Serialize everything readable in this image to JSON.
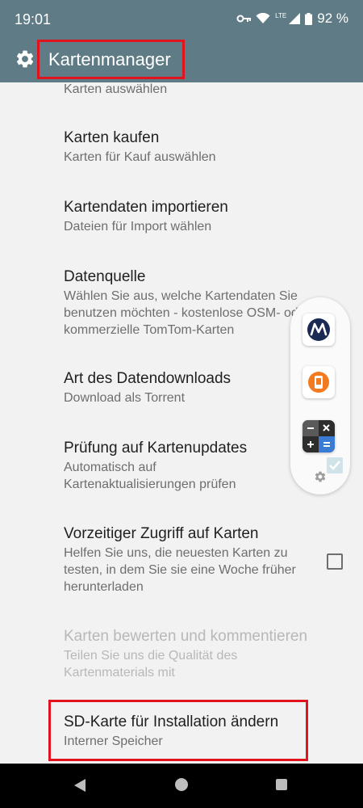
{
  "status": {
    "time": "19:01",
    "network": "LTE",
    "battery": "92 %"
  },
  "app_bar": {
    "title": "Kartenmanager"
  },
  "list": {
    "items": [
      {
        "title": "",
        "subtitle": "Karten auswählen"
      },
      {
        "title": "Karten kaufen",
        "subtitle": "Karten für Kauf auswählen"
      },
      {
        "title": "Kartendaten importieren",
        "subtitle": "Dateien für Import wählen"
      },
      {
        "title": "Datenquelle",
        "subtitle": "Wählen Sie aus, welche Kartendaten Sie benutzen möchten - kostenlose OSM- oder kommerzielle TomTom-Karten"
      },
      {
        "title": "Art des Datendownloads",
        "subtitle": "Download als Torrent"
      },
      {
        "title": "Prüfung auf Kartenupdates",
        "subtitle": "Automatisch auf Kartenaktualisierungen prüfen"
      },
      {
        "title": "Vorzeitiger Zugriff auf Karten",
        "subtitle": "Helfen Sie uns, die neuesten Karten zu testen, in dem Sie sie eine Woche früher herunterladen"
      },
      {
        "title": "Karten bewerten und kommentieren",
        "subtitle": "Teilen Sie uns die Qualität des Kartenmaterials mit"
      },
      {
        "title": "SD-Karte für Installation ändern",
        "subtitle": "Interner Speicher"
      }
    ],
    "early_access_checked": false
  },
  "floating_panel": {
    "apps": [
      "motorola-app-icon",
      "phone-manager-app-icon",
      "calculator-app-icon"
    ]
  },
  "colors": {
    "app_bar": "#5f7c86",
    "highlight": "#e0141e",
    "motorola_blue": "#1b2a52",
    "orange": "#f47a20"
  }
}
